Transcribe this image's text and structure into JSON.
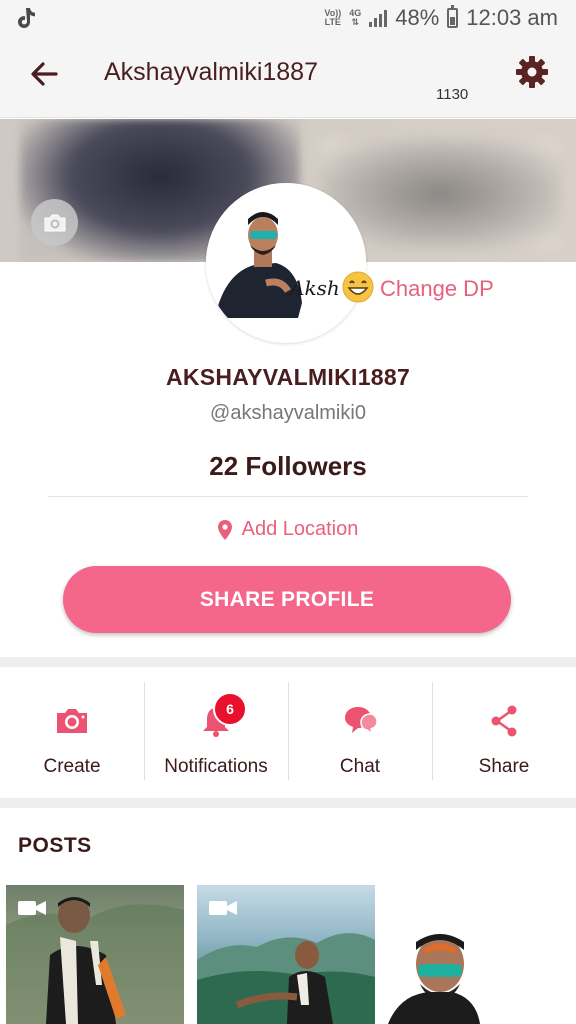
{
  "status_bar": {
    "network_top": "Vo))",
    "network_bottom": "LTE",
    "net_type": "4G",
    "battery_level": 0.48,
    "battery_text": "48%",
    "time": "12:03 am"
  },
  "header": {
    "title": "Akshayvalmiki1887",
    "counter": "1130"
  },
  "profile": {
    "change_dp_label": "Change DP",
    "avatar_signature": "Aksh",
    "display_name": "AKSHAYVALMIKI1887",
    "handle": "@akshayvalmiki0",
    "followers": "22 Followers",
    "location_label": "Add Location",
    "share_button_label": "SHARE PROFILE"
  },
  "actions": [
    {
      "label": "Create",
      "icon": "camera-icon"
    },
    {
      "label": "Notifications",
      "icon": "bell-icon",
      "badge": "6"
    },
    {
      "label": "Chat",
      "icon": "chat-icon"
    },
    {
      "label": "Share",
      "icon": "share-icon"
    }
  ],
  "posts": {
    "title": "POSTS"
  },
  "colors": {
    "accent": "#f4668a",
    "accent_text": "#e8607f",
    "badge": "#e8102c",
    "title_text": "#4a1e1e"
  }
}
